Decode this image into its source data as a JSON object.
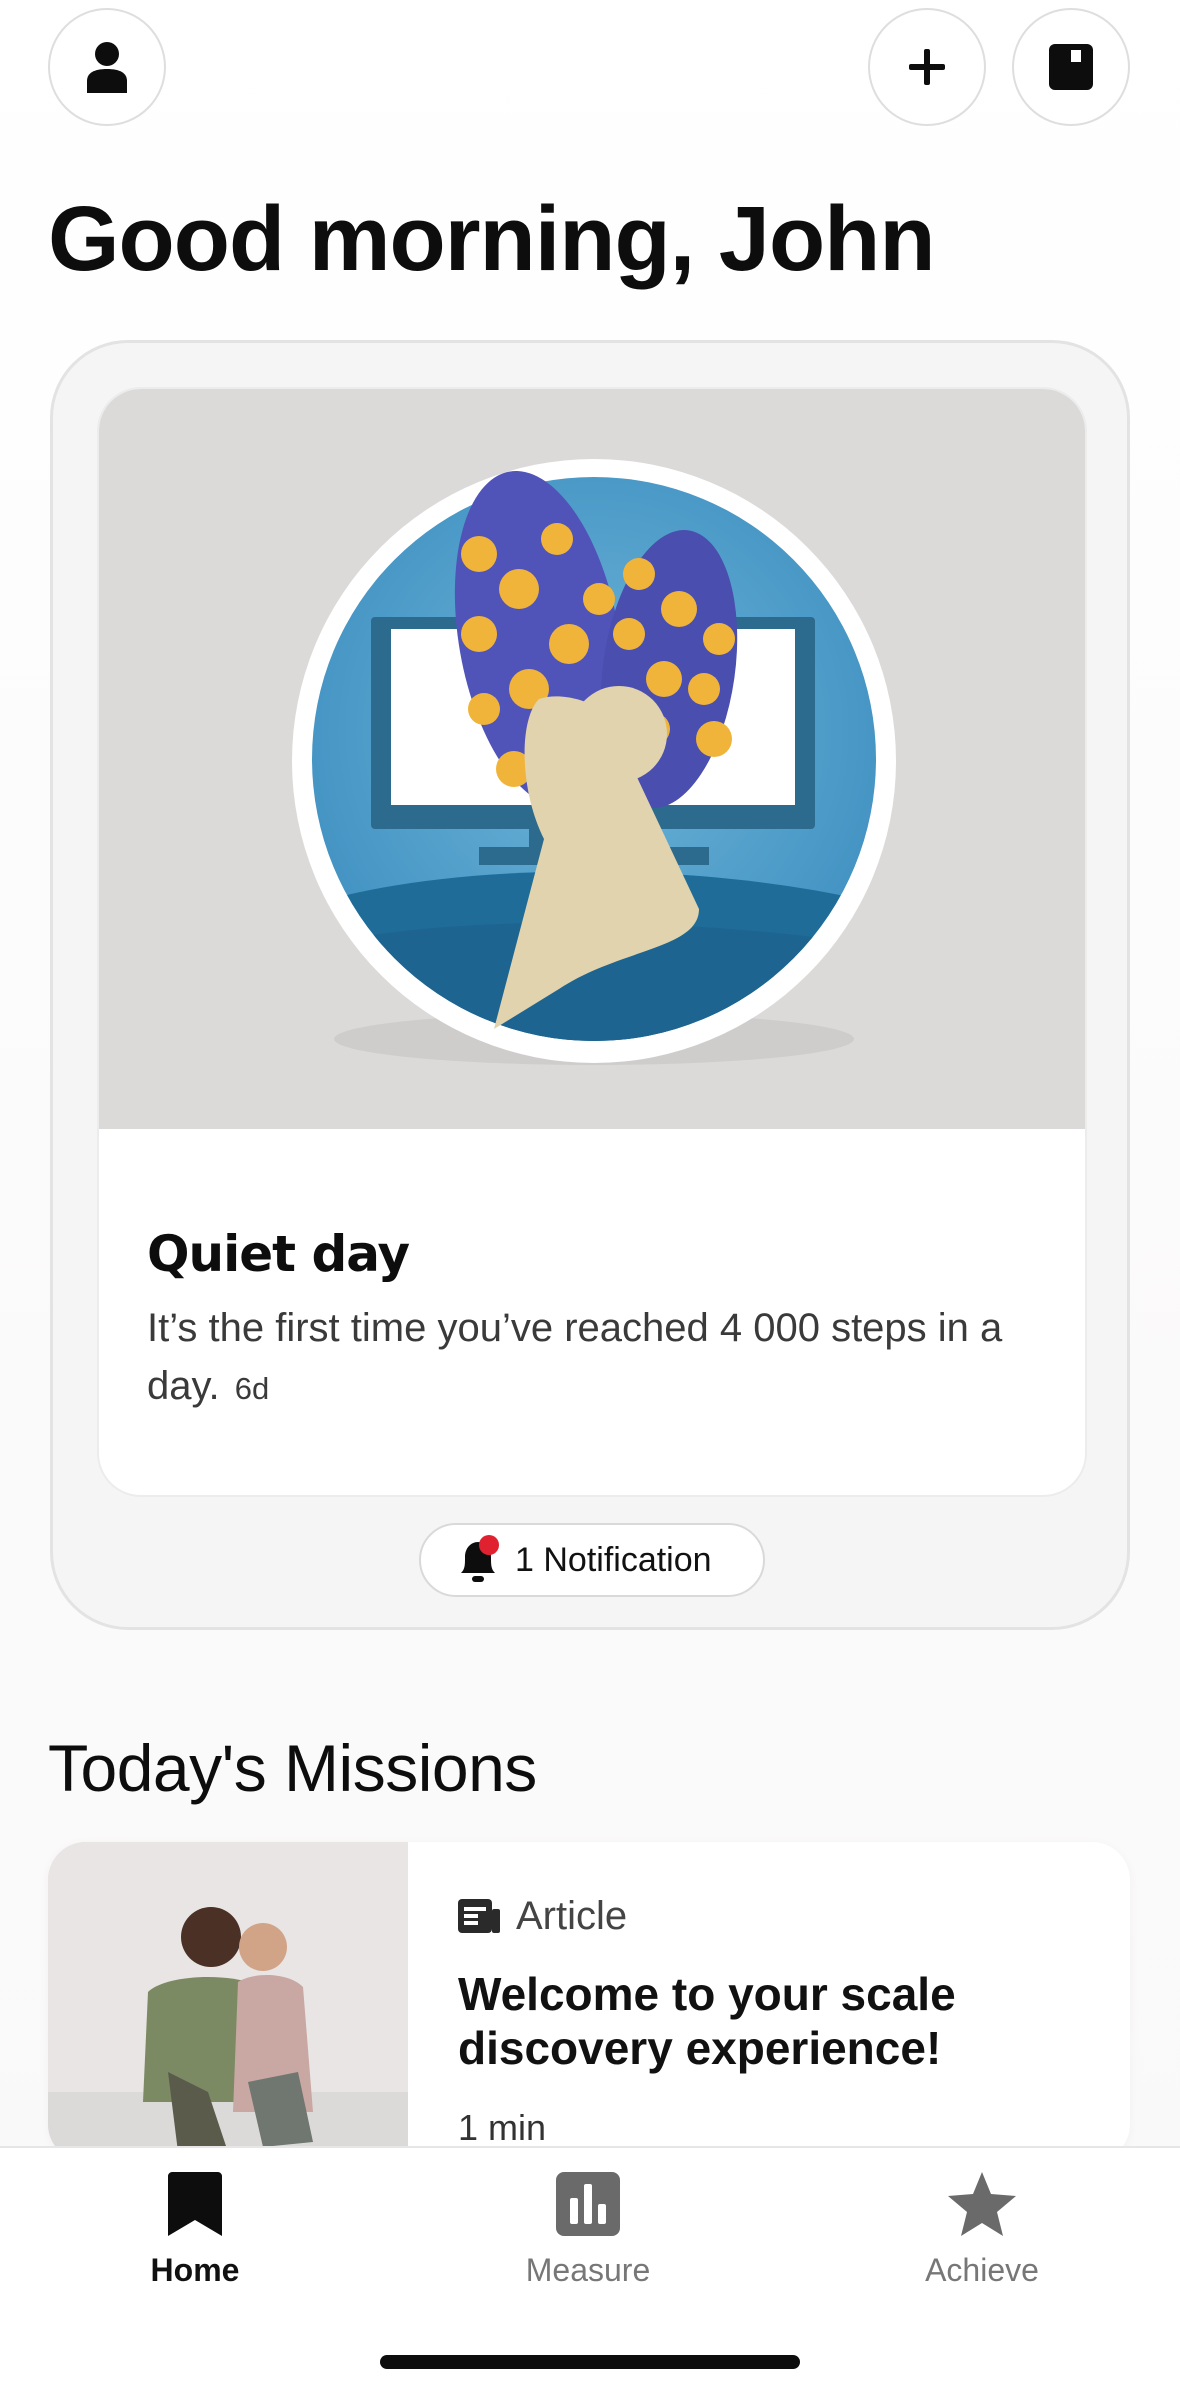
{
  "header": {
    "greeting": "Good morning, John",
    "icons": [
      "person-icon",
      "plus-icon",
      "notebook-icon"
    ]
  },
  "feed": {
    "title": "Quiet day",
    "text": "It’s the first time you’ve reached 4 000 steps in a day.",
    "time": "6d",
    "notification_label": "1 Notification"
  },
  "missions": {
    "title": "Today's Missions",
    "items": [
      {
        "type": "Article",
        "title": "Welcome to your scale discovery experience!",
        "duration": "1 min"
      }
    ]
  },
  "tabs": [
    {
      "label": "Home",
      "icon": "bookmark-icon",
      "active": true
    },
    {
      "label": "Measure",
      "icon": "bar-chart-icon",
      "active": false
    },
    {
      "label": "Achieve",
      "icon": "star-icon",
      "active": false
    }
  ],
  "colors": {
    "accent": "#0d0d0d",
    "badge": "#e0212f",
    "inactive": "#777777"
  }
}
